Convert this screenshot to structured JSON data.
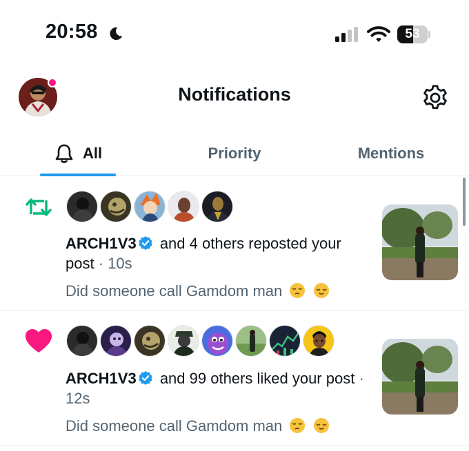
{
  "status_bar": {
    "time": "20:58",
    "moon_icon": "moon-icon",
    "signal_icon": "cellular-signal-icon",
    "wifi_icon": "wifi-icon",
    "battery_level": "53"
  },
  "header": {
    "title": "Notifications",
    "avatar_icon": "profile-avatar",
    "settings_icon": "gear-icon"
  },
  "tabs": [
    {
      "label": "All",
      "icon": "bell-icon",
      "active": true
    },
    {
      "label": "Priority",
      "active": false
    },
    {
      "label": "Mentions",
      "active": false
    }
  ],
  "notifications": [
    {
      "type_icon": "repost-icon",
      "user": "ARCH1V3",
      "verified": true,
      "action": " and 4 others reposted your post",
      "separator": " · ",
      "time": "10s",
      "snippet": "Did someone call Gamdom man",
      "avatar_count": 5
    },
    {
      "type_icon": "heart-icon",
      "user": "ARCH1V3",
      "verified": true,
      "action": " and 99 others liked your post",
      "separator": " · ",
      "time": "12s",
      "snippet": "Did someone call Gamdom man",
      "avatar_count": 8
    }
  ],
  "colors": {
    "accent": "#1d9bf0",
    "repost": "#00ba7c",
    "like": "#f91880",
    "secondary_text": "#536471"
  }
}
